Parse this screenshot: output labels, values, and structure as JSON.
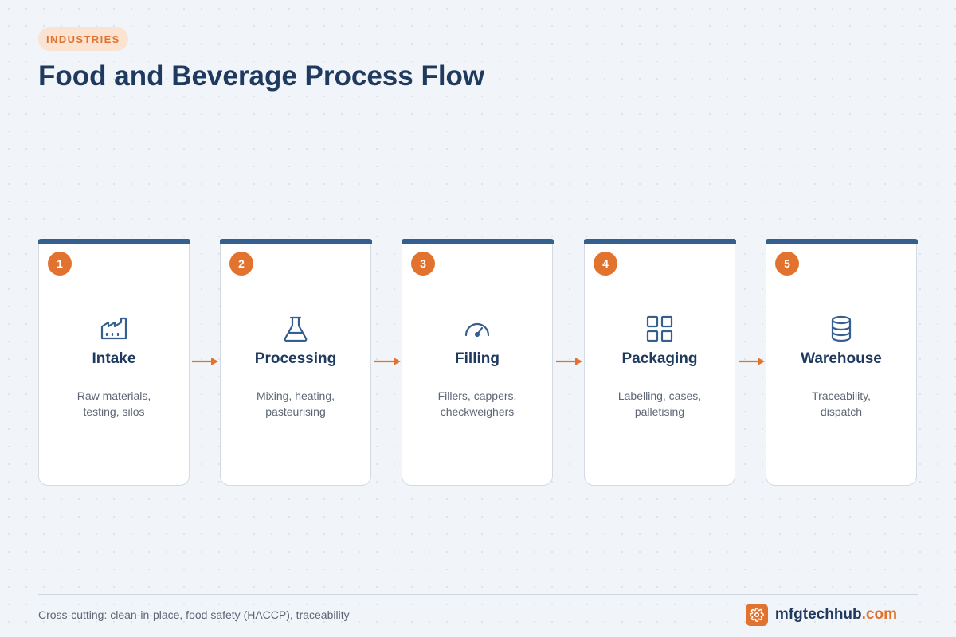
{
  "header": {
    "tag": "INDUSTRIES",
    "title": "Food and Beverage Process Flow"
  },
  "colors": {
    "accent": "#e2732f",
    "primary": "#355f8f",
    "heading": "#1f3a5f",
    "muted_text": "#5d6675",
    "card_border": "#d3dae3",
    "background": "#f1f4f8"
  },
  "steps": [
    {
      "number": "1",
      "title": "Intake",
      "desc_line1": "Raw materials,",
      "desc_line2": "testing, silos",
      "icon": "factory-icon"
    },
    {
      "number": "2",
      "title": "Processing",
      "desc_line1": "Mixing, heating,",
      "desc_line2": "pasteurising",
      "icon": "flask-icon"
    },
    {
      "number": "3",
      "title": "Filling",
      "desc_line1": "Fillers, cappers,",
      "desc_line2": "checkweighers",
      "icon": "gauge-icon"
    },
    {
      "number": "4",
      "title": "Packaging",
      "desc_line1": "Labelling, cases,",
      "desc_line2": "palletising",
      "icon": "grid-icon"
    },
    {
      "number": "5",
      "title": "Warehouse",
      "desc_line1": "Traceability,",
      "desc_line2": "dispatch",
      "icon": "database-icon"
    }
  ],
  "footer": {
    "note": "Cross-cutting: clean-in-place, food safety (HACCP), traceability",
    "brand_name": "mfgtechhub",
    "brand_tld": ".com",
    "brand_icon": "gear-icon"
  }
}
